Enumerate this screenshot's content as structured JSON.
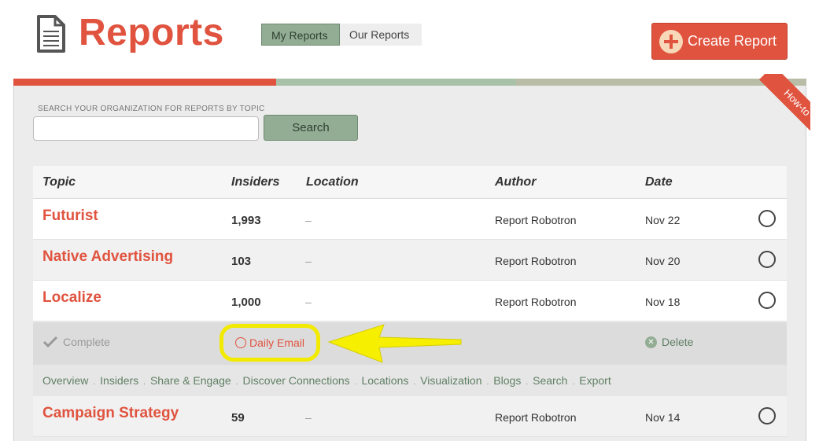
{
  "header": {
    "title": "Reports",
    "tabs": [
      {
        "label": "My Reports",
        "active": true
      },
      {
        "label": "Our Reports",
        "active": false
      }
    ],
    "create_label": "Create Report"
  },
  "accent_colors": {
    "red": "#e0533f",
    "green": "#93ad94",
    "olive": "#a8ad94"
  },
  "search": {
    "label": "SEARCH YOUR ORGANIZATION FOR REPORTS BY TOPIC",
    "value": "",
    "button_label": "Search"
  },
  "howto_label": "How-to",
  "table": {
    "columns": [
      "Topic",
      "Insiders",
      "Location",
      "Author",
      "Date"
    ],
    "rows": [
      {
        "topic": "Futurist",
        "insiders": "1,993",
        "location": "–",
        "author": "Report Robotron",
        "date": "Nov 22"
      },
      {
        "topic": "Native Advertising",
        "insiders": "103",
        "location": "–",
        "author": "Report Robotron",
        "date": "Nov 20"
      },
      {
        "topic": "Localize",
        "insiders": "1,000",
        "location": "–",
        "author": "Report Robotron",
        "date": "Nov 18"
      },
      {
        "topic": "Campaign Strategy",
        "insiders": "59",
        "location": "–",
        "author": "Report Robotron",
        "date": "Nov 14"
      }
    ]
  },
  "expanded": {
    "status": "Complete",
    "daily_email": "Daily Email",
    "delete": "Delete",
    "subnav": [
      "Overview",
      "Insiders",
      "Share & Engage",
      "Discover Connections",
      "Locations",
      "Visualization",
      "Blogs",
      "Search",
      "Export"
    ]
  },
  "icons": {
    "title": "document-icon",
    "create": "plus-circle-icon",
    "complete": "checkmark-icon",
    "daily": "circle-icon",
    "delete": "x-circle-icon",
    "select": "radio-circle-icon",
    "annotation": "yellow-arrow"
  }
}
